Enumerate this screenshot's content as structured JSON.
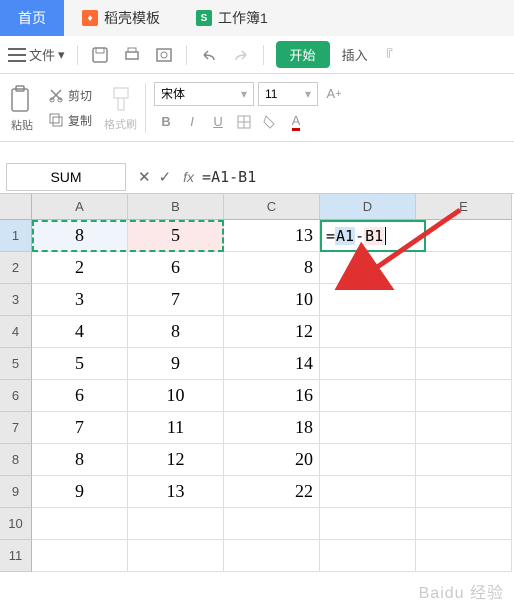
{
  "tabs": {
    "home": "首页",
    "docer": "稻壳模板",
    "workbook": "工作簿1"
  },
  "menubar": {
    "file": "文件",
    "start": "开始",
    "insert": "插入"
  },
  "toolbar": {
    "paste": "粘贴",
    "cut": "剪切",
    "copy": "复制",
    "format_painter": "格式刷",
    "font_name": "宋体",
    "font_size": "11"
  },
  "formula_bar": {
    "name_box": "SUM",
    "formula": "=A1-B1"
  },
  "sheet": {
    "columns": [
      "A",
      "B",
      "C",
      "D",
      "E"
    ],
    "rows": [
      "1",
      "2",
      "3",
      "4",
      "5",
      "6",
      "7",
      "8",
      "9",
      "10",
      "11"
    ],
    "data": {
      "A": [
        "8",
        "2",
        "3",
        "4",
        "5",
        "6",
        "7",
        "8",
        "9"
      ],
      "B": [
        "5",
        "6",
        "7",
        "8",
        "9",
        "10",
        "11",
        "12",
        "13"
      ],
      "C": [
        "13",
        "8",
        "10",
        "12",
        "14",
        "16",
        "18",
        "20",
        "22"
      ]
    },
    "editing_cell_display": "=A1-B1"
  },
  "watermark": "Baidu 经验"
}
